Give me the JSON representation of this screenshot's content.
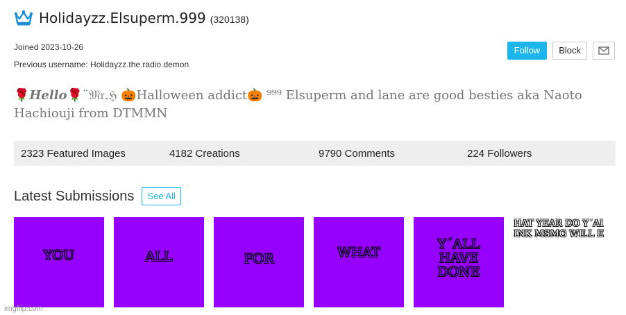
{
  "profile": {
    "username": "Holidayzz.Elsuperm.999",
    "user_id": "(320138)",
    "joined": "Joined 2023-10-26",
    "previous_username": "Previous username: Holidayzz.the.radio.demon",
    "icon": "crown-icon"
  },
  "actions": {
    "follow_label": "Follow",
    "block_label": "Block",
    "message_icon": "envelope-icon"
  },
  "bio": {
    "rose1": "🌹",
    "hello": "Hello",
    "rose2": "🌹",
    "mr": "¨𝔐𝔯.ℌ",
    "pumpkin1": "🎃",
    "text1": "Halloween addict",
    "pumpkin2": "🎃",
    "sup": "⁹⁹⁹",
    "text2": "Elsuperm and lane are good besties aka Naoto Hachiouji from DTMMN"
  },
  "stats": [
    {
      "label": "2323 Featured Images"
    },
    {
      "label": "4182 Creations"
    },
    {
      "label": "9790 Comments"
    },
    {
      "label": "224 Followers"
    }
  ],
  "latest": {
    "title": "Latest Submissions",
    "see_all_label": "See All"
  },
  "submissions": [
    {
      "caption": "YOU"
    },
    {
      "caption": "ALL"
    },
    {
      "caption": "FOR"
    },
    {
      "caption": "WHAT"
    },
    {
      "caption": "Y´ALL HAVE DONE"
    }
  ],
  "last_submission": {
    "line1": "HAT YEAR DO Y´AL",
    "line2": "INK MSMG WILL EN"
  },
  "watermark": "imgflip.com",
  "colors": {
    "accent": "#1bb6ec",
    "thumb_bg": "#9500ff",
    "stats_bg": "#eeeeee",
    "crown": "#1a8fd6"
  }
}
